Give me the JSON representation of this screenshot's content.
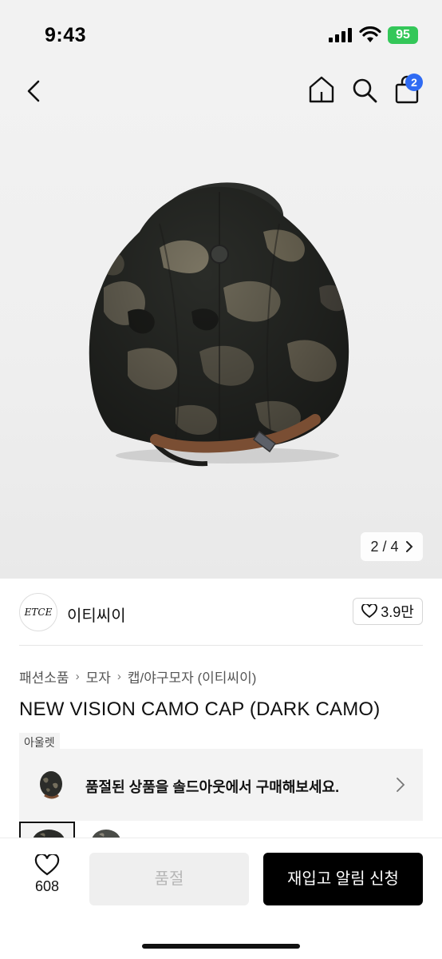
{
  "status_bar": {
    "time": "9:43",
    "battery": "95",
    "battery_color": "#34c759"
  },
  "nav": {
    "back_icon": "chevron-left-icon",
    "home_icon": "home-icon",
    "search_icon": "search-icon",
    "cart_icon": "shopping-bag-icon",
    "cart_count": "2",
    "badge_color": "#2f6bf3"
  },
  "gallery": {
    "current": "2",
    "total": "4",
    "separator": "/",
    "current_index": 2
  },
  "brand": {
    "logo_text": "ETCE",
    "name": "이티씨이",
    "likes": "3.9만"
  },
  "breadcrumb": [
    "패션소품",
    "모자",
    "캡/야구모자 (이티씨이)"
  ],
  "product": {
    "title": "NEW VISION CAMO CAP (DARK CAMO)"
  },
  "outlet": {
    "tag": "아울렛",
    "message": "품절된 상품을 솔드아웃에서 구매해보세요."
  },
  "bottom_bar": {
    "wish_count": "608",
    "soldout_label": "품절",
    "restock_label": "재입고 알림 신청",
    "primary_color": "#000000"
  }
}
